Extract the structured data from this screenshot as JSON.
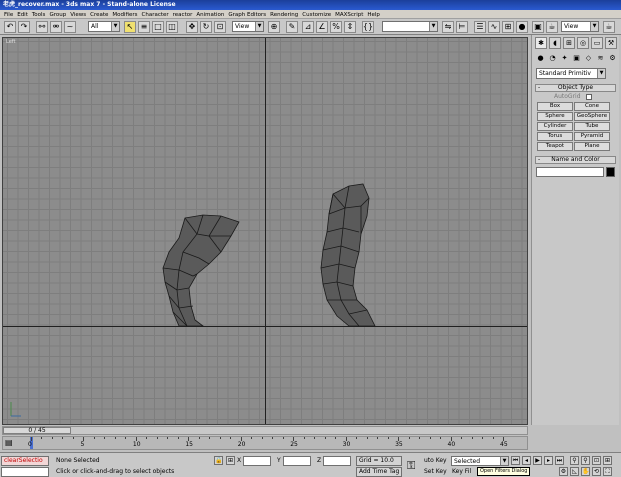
{
  "window": {
    "title": "老虎_recover.max - 3ds max 7 - Stand-alone License"
  },
  "menu": [
    "File",
    "Edit",
    "Tools",
    "Group",
    "Views",
    "Create",
    "Modifiers",
    "Character",
    "reactor",
    "Animation",
    "Graph Editors",
    "Rendering",
    "Customize",
    "MAXScript",
    "Help"
  ],
  "toolbar": {
    "selection_filter": "All",
    "ref_coord": "View",
    "named_sets": "",
    "right_view_dropdown": "View"
  },
  "viewport": {
    "label": "Left"
  },
  "command_panel": {
    "primitive_type": "Standard Primitiv",
    "object_type_title": "Object Type",
    "autogrid": "AutoGrid",
    "buttons": [
      "Box",
      "Cone",
      "Sphere",
      "GeoSphere",
      "Cylinder",
      "Tube",
      "Torus",
      "Pyramid",
      "Teapot",
      "Plane"
    ],
    "name_color_title": "Name and Color",
    "color": "#000000"
  },
  "timeline": {
    "frame_display": "0 / 45",
    "current_frame": 0,
    "total_frames": 45,
    "ticks": [
      "0",
      "5",
      "10",
      "15",
      "20",
      "25",
      "30",
      "35",
      "40",
      "45"
    ]
  },
  "status": {
    "maxscript_text": "clearSelectio",
    "selection": "None Selected",
    "prompt": "Click or click-and-drag to select objects",
    "x_label": "X",
    "y_label": "Y",
    "z_label": "Z",
    "x_value": "",
    "y_value": "",
    "z_value": "",
    "grid": "Grid = 10.0",
    "add_time_tag": "Add Time Tag",
    "auto_key": "uto Key",
    "auto_key_mode": "Selected",
    "set_key": "Set Key",
    "key_filters": "Key Fil",
    "tooltip": "Open Filters Dialog"
  },
  "colors": {
    "viewport_bg": "#8c8c8c",
    "grid": "#7e7e7e",
    "mesh": "#3a3a3a",
    "title_bar": "#1b3f9a"
  }
}
